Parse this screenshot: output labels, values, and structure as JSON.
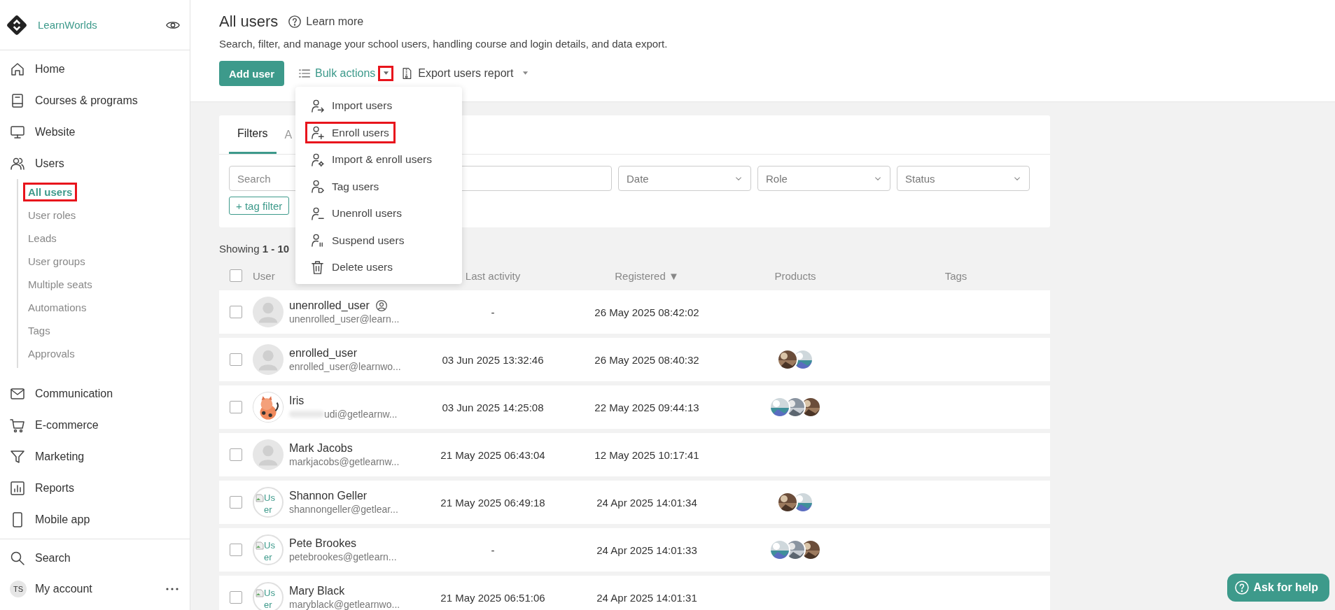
{
  "sidebar": {
    "brand": "LearnWorlds",
    "items": [
      {
        "label": "Home",
        "selected": false
      },
      {
        "label": "Courses & programs",
        "selected": false
      },
      {
        "label": "Website",
        "selected": false
      },
      {
        "label": "Users",
        "selected": false,
        "children": [
          {
            "label": "All users",
            "selected": true,
            "highlighted": true
          },
          {
            "label": "User roles",
            "selected": false,
            "highlighted": false
          },
          {
            "label": "Leads",
            "selected": false,
            "highlighted": false
          },
          {
            "label": "User groups",
            "selected": false,
            "highlighted": false
          },
          {
            "label": "Multiple seats",
            "selected": false,
            "highlighted": false
          },
          {
            "label": "Automations",
            "selected": false,
            "highlighted": false
          },
          {
            "label": "Tags",
            "selected": false,
            "highlighted": false
          },
          {
            "label": "Approvals",
            "selected": false,
            "highlighted": false
          }
        ]
      },
      {
        "label": "Communication",
        "selected": false
      },
      {
        "label": "E-commerce",
        "selected": false
      },
      {
        "label": "Marketing",
        "selected": false
      },
      {
        "label": "Reports",
        "selected": false
      },
      {
        "label": "Mobile app",
        "selected": false
      }
    ],
    "search": "Search",
    "account": {
      "initials": "TS",
      "label": "My account"
    }
  },
  "header": {
    "title": "All users",
    "learn_more": "Learn more",
    "description": "Search, filter, and manage your school users, handling course and login details, and data export.",
    "add_button": "Add user",
    "bulk_actions": {
      "label": "Bulk actions",
      "caret_highlighted": true,
      "expanded": true
    },
    "export": "Export users report"
  },
  "bulk_menu": [
    {
      "kind": "import",
      "label": "Import users",
      "highlighted": false
    },
    {
      "kind": "enroll",
      "label": "Enroll users",
      "highlighted": true
    },
    {
      "kind": "import-enroll",
      "label": "Import & enroll users",
      "highlighted": false
    },
    {
      "kind": "tag",
      "label": "Tag users",
      "highlighted": false
    },
    {
      "kind": "unenroll",
      "label": "Unenroll users",
      "highlighted": false
    },
    {
      "kind": "suspend",
      "label": "Suspend users",
      "highlighted": false
    },
    {
      "kind": "delete",
      "label": "Delete users",
      "highlighted": false
    }
  ],
  "filters": {
    "tabs": [
      {
        "label": "Filters",
        "selected": true
      },
      {
        "label": "A",
        "selected": false
      }
    ],
    "fields": [
      {
        "kind": "search",
        "placeholder": "Search"
      },
      {
        "kind": "select"
      },
      {
        "kind": "select",
        "placeholder": "Date"
      },
      {
        "kind": "select",
        "placeholder": "Role"
      },
      {
        "kind": "select",
        "placeholder": "Status"
      }
    ],
    "tag_filter": "+ tag filter"
  },
  "showing": "Showing **1 - 10**",
  "table": {
    "select_all": {
      "checked": false
    },
    "columns": [
      "User",
      "Last activity",
      "Registered ▼",
      "Products",
      "Tags"
    ],
    "rows": [
      {
        "checked": false,
        "avatar": {
          "kind": "default"
        },
        "name": "unenrolled_user",
        "badge": true,
        "email": "unenrolled_user@learn...",
        "email_blurred": false,
        "last_activity": "-",
        "registered": "26 May 2025 08:42:02",
        "products": []
      },
      {
        "checked": false,
        "avatar": {
          "kind": "default"
        },
        "name": "enrolled_user",
        "badge": false,
        "email": "enrolled_user@learnwo...",
        "email_blurred": false,
        "last_activity": "03 Jun 2025 13:32:46",
        "registered": "26 May 2025 08:40:32"
      },
      {
        "checked": false,
        "name": "Iris",
        "badge": false,
        "email": "udi@getlearnw...",
        "email_blurred": true,
        "last_activity": "03 Jun 2025 14:25:08",
        "registered": "22 May 2025 09:44:13"
      },
      {
        "checked": false,
        "avatar": {
          "kind": "default"
        },
        "name": "Mark Jacobs",
        "badge": false,
        "email": "markjacobs@getlearnw...",
        "email_blurred": false,
        "last_activity": "21 May 2025 06:43:04",
        "registered": "12 May 2025 10:17:41",
        "products": []
      },
      {
        "checked": false,
        "avatar": {
          "kind": "broken",
          "alt": "User"
        },
        "name": "Shannon Geller",
        "badge": false,
        "email": "shannongeller@getlear...",
        "email_blurred": false,
        "last_activity": "21 May 2025 06:49:18",
        "registered": "24 Apr 2025 14:01:34"
      },
      {
        "checked": false,
        "avatar": {
          "kind": "broken",
          "alt": "User"
        },
        "name": "Pete Brookes",
        "badge": false,
        "email": "petebrookes@getlearn...",
        "email_blurred": false,
        "last_activity": "-",
        "registered": "24 Apr 2025 14:01:33"
      },
      {
        "checked": false,
        "avatar": {
          "kind": "broken",
          "alt": "User"
        },
        "name": "Mary Black",
        "badge": false,
        "email": "maryblack@getlearnwo...",
        "email_blurred": false,
        "last_activity": "21 May 2025 06:51:06",
        "registered": "24 Apr 2025 14:01:31",
        "products": []
      }
    ]
  },
  "help_button": "Ask for help"
}
